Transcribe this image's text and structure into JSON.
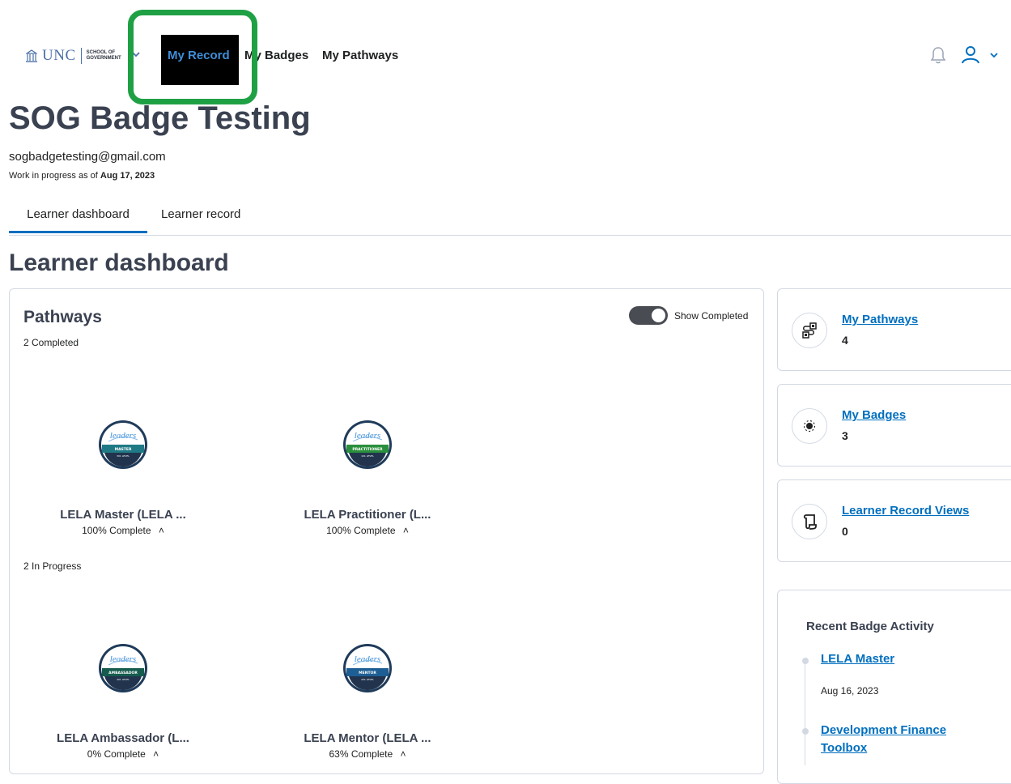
{
  "nav": {
    "logo_text": "UNC",
    "logo_sub_line1": "SCHOOL OF",
    "logo_sub_line2": "GOVERNMENT",
    "my_record": "My Record",
    "my_badges": "My Badges",
    "my_pathways": "My Pathways"
  },
  "header": {
    "title": "SOG Badge Testing",
    "email": "sogbadgetesting@gmail.com",
    "progress_prefix": "Work in progress as of ",
    "progress_date": "Aug 17, 2023"
  },
  "tabs": [
    {
      "label": "Learner dashboard",
      "active": true
    },
    {
      "label": "Learner record",
      "active": false
    }
  ],
  "dashboard": {
    "title": "Learner dashboard",
    "pathways": {
      "title": "Pathways",
      "toggle_label": "Show Completed",
      "toggle_on": true,
      "completed_label": "2 Completed",
      "in_progress_label": "2 In Progress",
      "completed_items": [
        {
          "name": "LELA Master (LELA ...",
          "progress": "100% Complete",
          "badge_level": "MASTER",
          "badge_sub": "301 LEVEL",
          "badge_color": "#1f7a86"
        },
        {
          "name": "LELA Practitioner (L...",
          "progress": "100% Complete",
          "badge_level": "PRACTITIONER",
          "badge_sub": "101 LEVEL",
          "badge_color": "#2a8f3c"
        }
      ],
      "in_progress_items": [
        {
          "name": "LELA Ambassador (L...",
          "progress": "0% Complete",
          "badge_level": "AMBASSADOR",
          "badge_sub": "401 LEVEL",
          "badge_color": "#155c4e"
        },
        {
          "name": "LELA Mentor (LELA ...",
          "progress": "63% Complete",
          "badge_level": "MENTOR",
          "badge_sub": "201 LEVEL",
          "badge_color": "#1d5f94"
        }
      ]
    },
    "stats": [
      {
        "label": "My Pathways",
        "value": "4",
        "icon": "pathway-icon"
      },
      {
        "label": "My Badges",
        "value": "3",
        "icon": "badge-icon"
      },
      {
        "label": "Learner Record Views",
        "value": "0",
        "icon": "scroll-icon"
      }
    ],
    "activity": {
      "title": "Recent Badge Activity",
      "items": [
        {
          "title": "LELA Master",
          "date": "Aug 16, 2023"
        },
        {
          "title_line1": "Development Finance",
          "title_line2": "Toolbox"
        }
      ]
    }
  },
  "colors": {
    "accent": "#006fbf",
    "highlight_box": "#1fa045",
    "title": "#3a4150"
  }
}
